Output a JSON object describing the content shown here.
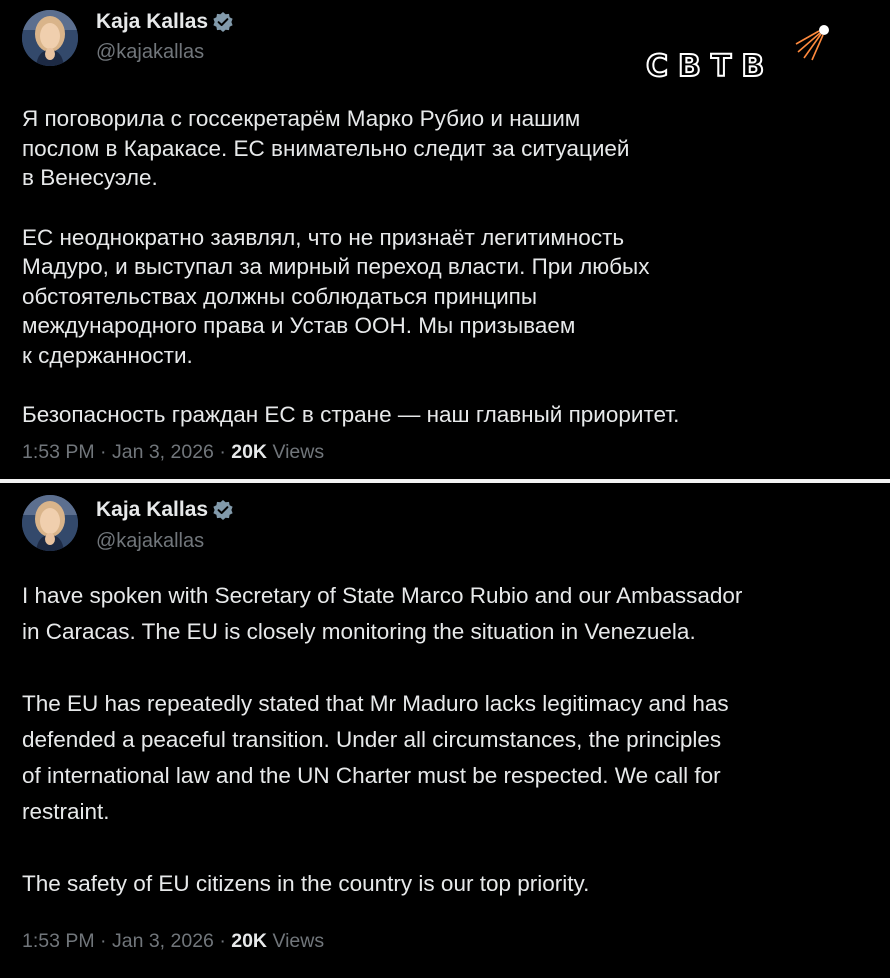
{
  "colors": {
    "background": "#000000",
    "text": "#e7e9ea",
    "secondary_text": "#71767b",
    "verified_badge": "#829aab",
    "divider": "#f2f2f2"
  },
  "logo": {
    "text": "СВТВ",
    "icon": "sputnik-icon"
  },
  "posts": [
    {
      "author": {
        "name": "Kaja Kallas",
        "handle": "@kajakallas",
        "verified_icon": "verified-badge-icon"
      },
      "paragraphs": [
        "Я поговорила с госсекретарём Марко Рубио и нашим\nпослом в Каракасе. ЕС внимательно следит за ситуацией\nв Венесуэле.",
        "ЕС неоднократно заявлял, что не признаёт легитимность\nМадуро, и выступал за мирный переход власти. При любых\nобстоятельствах должны соблюдаться принципы\nмеждународного права и Устав ООН. Мы призываем\nк сдержанности.",
        "Безопасность граждан ЕС в стране — наш главный приоритет."
      ],
      "time": "1:53 PM",
      "date": "Jan 3, 2026",
      "views_count": "20K",
      "views_label": "Views"
    },
    {
      "author": {
        "name": "Kaja Kallas",
        "handle": "@kajakallas",
        "verified_icon": "verified-badge-icon"
      },
      "paragraphs": [
        "I have spoken with Secretary of State Marco Rubio and our Ambassador\nin Caracas. The EU is closely monitoring the situation in Venezuela.",
        "The EU has repeatedly stated that Mr Maduro lacks legitimacy and has\ndefended a peaceful transition. Under all circumstances, the principles\nof international law and the UN Charter must be respected. We call for\nrestraint.",
        "The safety of EU citizens in the country is our top priority."
      ],
      "time": "1:53 PM",
      "date": "Jan 3, 2026",
      "views_count": "20K",
      "views_label": "Views"
    }
  ]
}
